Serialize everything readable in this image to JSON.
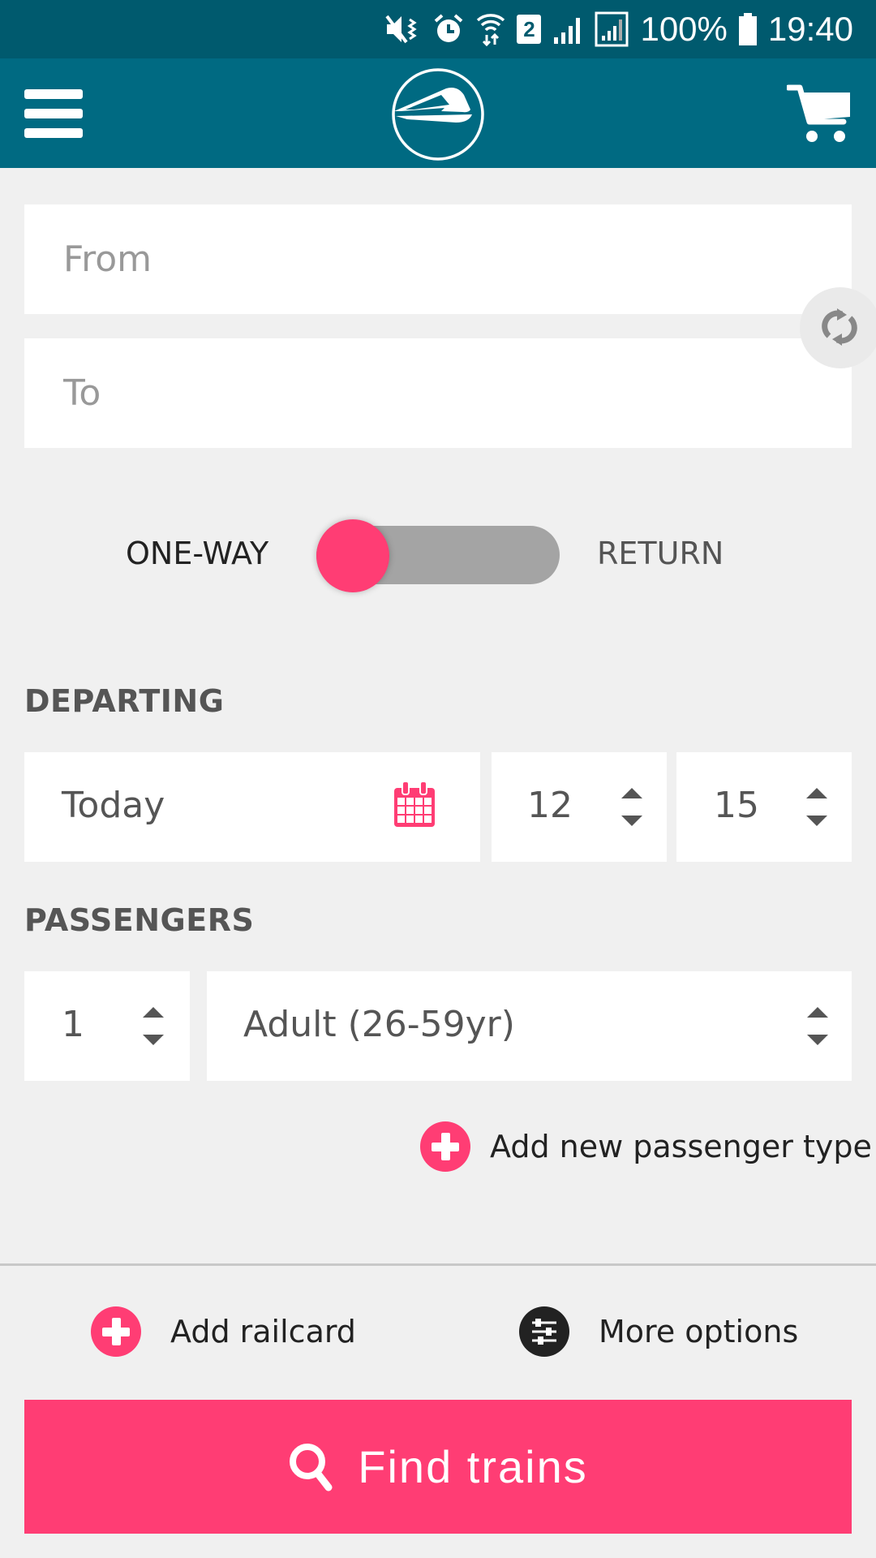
{
  "status_bar": {
    "icons": [
      "mute-vibrate-icon",
      "alarm-icon",
      "wifi-data-icon",
      "sim-2-icon",
      "signal-icon",
      "signal-roaming-icon",
      "battery-icon"
    ],
    "sim_label": "2",
    "battery": "100%",
    "time": "19:40"
  },
  "app_bar": {
    "menu_icon": "hamburger-menu-icon",
    "logo_icon": "train-logo-icon",
    "cart_icon": "shopping-cart-icon"
  },
  "journey": {
    "from_placeholder": "From",
    "from_value": "",
    "to_placeholder": "To",
    "to_value": "",
    "swap_icon": "swap-refresh-icon"
  },
  "trip_type": {
    "left_label": "ONE-WAY",
    "right_label": "RETURN",
    "selected": "ONE-WAY"
  },
  "departing": {
    "label": "DEPARTING",
    "date": "Today",
    "calendar_icon": "calendar-icon",
    "hour": "12",
    "minute": "15"
  },
  "passengers": {
    "label": "PASSENGERS",
    "count": "1",
    "type": "Adult (26-59yr)",
    "add_type_label": "Add new passenger type"
  },
  "options": {
    "add_railcard_label": "Add railcard",
    "more_options_label": "More options"
  },
  "search": {
    "button_label": "Find trains"
  },
  "colors": {
    "status_bar": "#005a6e",
    "app_bar": "#006a82",
    "accent": "#ff3d74",
    "background": "#f0f0f0",
    "toggle_track": "#a4a4a4"
  }
}
